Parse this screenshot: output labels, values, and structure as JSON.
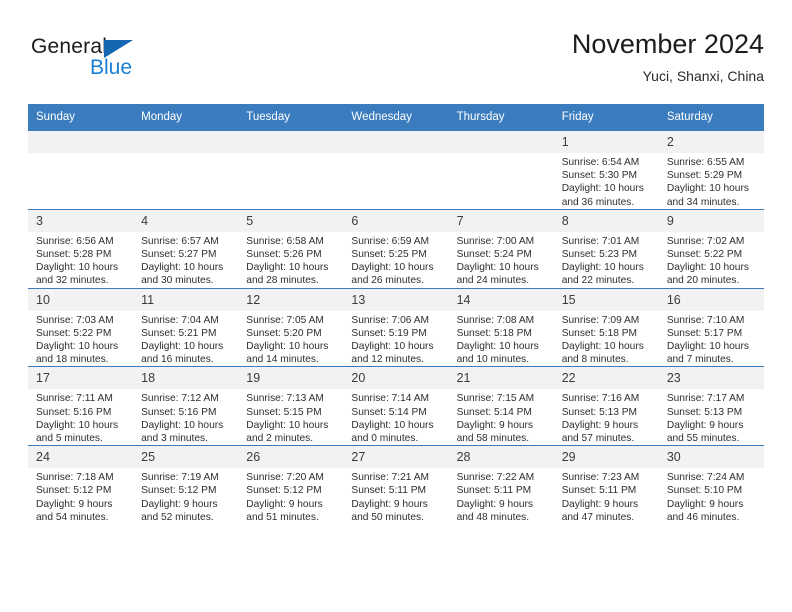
{
  "brand": {
    "name_top": "General",
    "name_bottom": "Blue",
    "accent_color": "#1667b2",
    "blue_text_color": "#1a7fd4"
  },
  "header": {
    "title": "November 2024",
    "subtitle": "Yuci, Shanxi, China"
  },
  "theme": {
    "header_bg": "#3a7cbe",
    "daynum_bg": "#f2f2f2",
    "row_border": "#3a7cbe"
  },
  "weekdays": [
    "Sunday",
    "Monday",
    "Tuesday",
    "Wednesday",
    "Thursday",
    "Friday",
    "Saturday"
  ],
  "weeks": [
    [
      {
        "day": "",
        "empty": true
      },
      {
        "day": "",
        "empty": true
      },
      {
        "day": "",
        "empty": true
      },
      {
        "day": "",
        "empty": true
      },
      {
        "day": "",
        "empty": true
      },
      {
        "day": "1",
        "sunrise": "Sunrise: 6:54 AM",
        "sunset": "Sunset: 5:30 PM",
        "daylight_1": "Daylight: 10 hours",
        "daylight_2": "and 36 minutes."
      },
      {
        "day": "2",
        "sunrise": "Sunrise: 6:55 AM",
        "sunset": "Sunset: 5:29 PM",
        "daylight_1": "Daylight: 10 hours",
        "daylight_2": "and 34 minutes."
      }
    ],
    [
      {
        "day": "3",
        "sunrise": "Sunrise: 6:56 AM",
        "sunset": "Sunset: 5:28 PM",
        "daylight_1": "Daylight: 10 hours",
        "daylight_2": "and 32 minutes."
      },
      {
        "day": "4",
        "sunrise": "Sunrise: 6:57 AM",
        "sunset": "Sunset: 5:27 PM",
        "daylight_1": "Daylight: 10 hours",
        "daylight_2": "and 30 minutes."
      },
      {
        "day": "5",
        "sunrise": "Sunrise: 6:58 AM",
        "sunset": "Sunset: 5:26 PM",
        "daylight_1": "Daylight: 10 hours",
        "daylight_2": "and 28 minutes."
      },
      {
        "day": "6",
        "sunrise": "Sunrise: 6:59 AM",
        "sunset": "Sunset: 5:25 PM",
        "daylight_1": "Daylight: 10 hours",
        "daylight_2": "and 26 minutes."
      },
      {
        "day": "7",
        "sunrise": "Sunrise: 7:00 AM",
        "sunset": "Sunset: 5:24 PM",
        "daylight_1": "Daylight: 10 hours",
        "daylight_2": "and 24 minutes."
      },
      {
        "day": "8",
        "sunrise": "Sunrise: 7:01 AM",
        "sunset": "Sunset: 5:23 PM",
        "daylight_1": "Daylight: 10 hours",
        "daylight_2": "and 22 minutes."
      },
      {
        "day": "9",
        "sunrise": "Sunrise: 7:02 AM",
        "sunset": "Sunset: 5:22 PM",
        "daylight_1": "Daylight: 10 hours",
        "daylight_2": "and 20 minutes."
      }
    ],
    [
      {
        "day": "10",
        "sunrise": "Sunrise: 7:03 AM",
        "sunset": "Sunset: 5:22 PM",
        "daylight_1": "Daylight: 10 hours",
        "daylight_2": "and 18 minutes."
      },
      {
        "day": "11",
        "sunrise": "Sunrise: 7:04 AM",
        "sunset": "Sunset: 5:21 PM",
        "daylight_1": "Daylight: 10 hours",
        "daylight_2": "and 16 minutes."
      },
      {
        "day": "12",
        "sunrise": "Sunrise: 7:05 AM",
        "sunset": "Sunset: 5:20 PM",
        "daylight_1": "Daylight: 10 hours",
        "daylight_2": "and 14 minutes."
      },
      {
        "day": "13",
        "sunrise": "Sunrise: 7:06 AM",
        "sunset": "Sunset: 5:19 PM",
        "daylight_1": "Daylight: 10 hours",
        "daylight_2": "and 12 minutes."
      },
      {
        "day": "14",
        "sunrise": "Sunrise: 7:08 AM",
        "sunset": "Sunset: 5:18 PM",
        "daylight_1": "Daylight: 10 hours",
        "daylight_2": "and 10 minutes."
      },
      {
        "day": "15",
        "sunrise": "Sunrise: 7:09 AM",
        "sunset": "Sunset: 5:18 PM",
        "daylight_1": "Daylight: 10 hours",
        "daylight_2": "and 8 minutes."
      },
      {
        "day": "16",
        "sunrise": "Sunrise: 7:10 AM",
        "sunset": "Sunset: 5:17 PM",
        "daylight_1": "Daylight: 10 hours",
        "daylight_2": "and 7 minutes."
      }
    ],
    [
      {
        "day": "17",
        "sunrise": "Sunrise: 7:11 AM",
        "sunset": "Sunset: 5:16 PM",
        "daylight_1": "Daylight: 10 hours",
        "daylight_2": "and 5 minutes."
      },
      {
        "day": "18",
        "sunrise": "Sunrise: 7:12 AM",
        "sunset": "Sunset: 5:16 PM",
        "daylight_1": "Daylight: 10 hours",
        "daylight_2": "and 3 minutes."
      },
      {
        "day": "19",
        "sunrise": "Sunrise: 7:13 AM",
        "sunset": "Sunset: 5:15 PM",
        "daylight_1": "Daylight: 10 hours",
        "daylight_2": "and 2 minutes."
      },
      {
        "day": "20",
        "sunrise": "Sunrise: 7:14 AM",
        "sunset": "Sunset: 5:14 PM",
        "daylight_1": "Daylight: 10 hours",
        "daylight_2": "and 0 minutes."
      },
      {
        "day": "21",
        "sunrise": "Sunrise: 7:15 AM",
        "sunset": "Sunset: 5:14 PM",
        "daylight_1": "Daylight: 9 hours",
        "daylight_2": "and 58 minutes."
      },
      {
        "day": "22",
        "sunrise": "Sunrise: 7:16 AM",
        "sunset": "Sunset: 5:13 PM",
        "daylight_1": "Daylight: 9 hours",
        "daylight_2": "and 57 minutes."
      },
      {
        "day": "23",
        "sunrise": "Sunrise: 7:17 AM",
        "sunset": "Sunset: 5:13 PM",
        "daylight_1": "Daylight: 9 hours",
        "daylight_2": "and 55 minutes."
      }
    ],
    [
      {
        "day": "24",
        "sunrise": "Sunrise: 7:18 AM",
        "sunset": "Sunset: 5:12 PM",
        "daylight_1": "Daylight: 9 hours",
        "daylight_2": "and 54 minutes."
      },
      {
        "day": "25",
        "sunrise": "Sunrise: 7:19 AM",
        "sunset": "Sunset: 5:12 PM",
        "daylight_1": "Daylight: 9 hours",
        "daylight_2": "and 52 minutes."
      },
      {
        "day": "26",
        "sunrise": "Sunrise: 7:20 AM",
        "sunset": "Sunset: 5:12 PM",
        "daylight_1": "Daylight: 9 hours",
        "daylight_2": "and 51 minutes."
      },
      {
        "day": "27",
        "sunrise": "Sunrise: 7:21 AM",
        "sunset": "Sunset: 5:11 PM",
        "daylight_1": "Daylight: 9 hours",
        "daylight_2": "and 50 minutes."
      },
      {
        "day": "28",
        "sunrise": "Sunrise: 7:22 AM",
        "sunset": "Sunset: 5:11 PM",
        "daylight_1": "Daylight: 9 hours",
        "daylight_2": "and 48 minutes."
      },
      {
        "day": "29",
        "sunrise": "Sunrise: 7:23 AM",
        "sunset": "Sunset: 5:11 PM",
        "daylight_1": "Daylight: 9 hours",
        "daylight_2": "and 47 minutes."
      },
      {
        "day": "30",
        "sunrise": "Sunrise: 7:24 AM",
        "sunset": "Sunset: 5:10 PM",
        "daylight_1": "Daylight: 9 hours",
        "daylight_2": "and 46 minutes."
      }
    ]
  ]
}
